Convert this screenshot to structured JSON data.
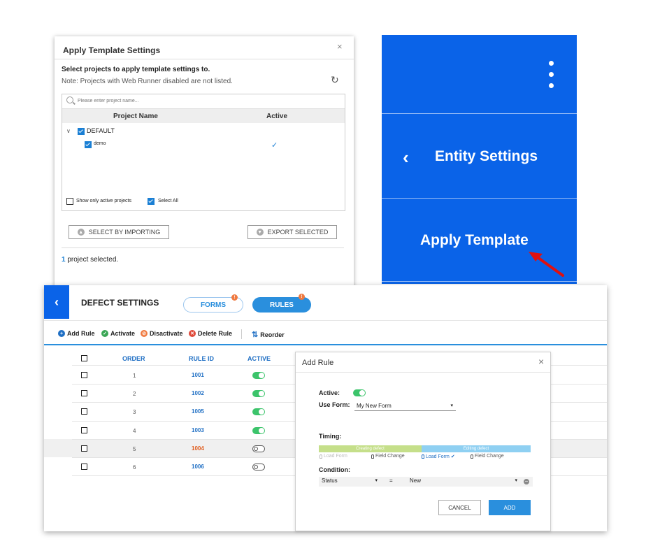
{
  "apply_dialog": {
    "title": "Apply Template Settings",
    "close": "×",
    "heading": "Select projects to apply template settings to.",
    "note": "Note: Projects with Web Runner disabled are not listed.",
    "search_placeholder": "Please enter project name...",
    "columns": {
      "name": "Project Name",
      "active": "Active"
    },
    "tree": [
      {
        "label": "DEFAULT",
        "checked": true,
        "expanded": true,
        "children": [
          {
            "label": "demo",
            "checked": true,
            "active": true
          }
        ]
      }
    ],
    "show_active_label": "Show only active projects",
    "select_all_label": "Select All",
    "select_importing": "SELECT BY IMPORTING",
    "export_selected": "EXPORT SELECTED",
    "selected_count": "1",
    "selected_suffix": " project selected."
  },
  "blue_menu": {
    "entity_settings": "Entity Settings",
    "apply_template": "Apply Template",
    "back_glyph": "‹"
  },
  "defect": {
    "back_glyph": "‹",
    "title": "DEFECT SETTINGS",
    "tabs": {
      "forms": "FORMS",
      "rules": "RULES"
    },
    "toolbar": {
      "add": "Add Rule",
      "activate": "Activate",
      "disactivate": "Disactivate",
      "delete": "Delete Rule",
      "reorder": "Reorder"
    },
    "columns": {
      "order": "ORDER",
      "rule_id": "RULE ID",
      "active": "ACTIVE"
    },
    "rows": [
      {
        "order": "1",
        "rule_id": "1001",
        "active": true
      },
      {
        "order": "2",
        "rule_id": "1002",
        "active": true
      },
      {
        "order": "3",
        "rule_id": "1005",
        "active": true
      },
      {
        "order": "4",
        "rule_id": "1003",
        "active": true
      },
      {
        "order": "5",
        "rule_id": "1004",
        "active": false
      },
      {
        "order": "6",
        "rule_id": "1006",
        "active": false
      }
    ]
  },
  "add_rule": {
    "title": "Add Rule",
    "close": "×",
    "active_label": "Active:",
    "use_form_label": "Use Form:",
    "use_form_value": "My New Form",
    "timing_label": "Timing:",
    "creating": "Creating defect",
    "editing": "Editing defect",
    "timing_items": {
      "load1": "Load Form",
      "field1": "Field Change",
      "load2": "Load Form",
      "field2": "Field Change"
    },
    "condition_label": "Condition:",
    "condition_field": "Status",
    "condition_op": "=",
    "condition_value": "New",
    "cancel": "CANCEL",
    "add": "ADD"
  },
  "colors": {
    "accent": "#2a8fdd",
    "menu_blue": "#0a63e8",
    "toggle_on": "#3cc46b",
    "warn": "#e05a1a"
  }
}
